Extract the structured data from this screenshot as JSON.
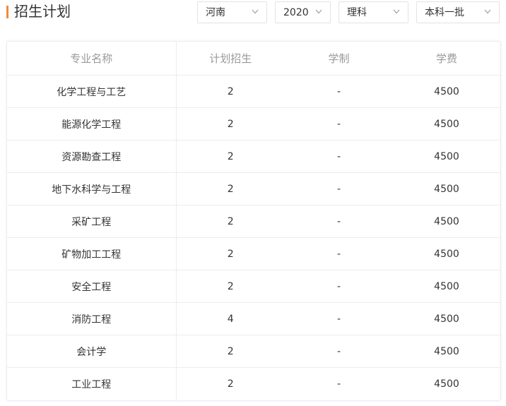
{
  "header": {
    "title": "招生计划",
    "accent_color": "#f08a3c"
  },
  "filters": {
    "province": "河南",
    "year": "2020",
    "subject": "理科",
    "batch": "本科一批",
    "dropdown_icon": "chevron-down-icon"
  },
  "table": {
    "headers": [
      "专业名称",
      "计划招生",
      "学制",
      "学费"
    ],
    "rows": [
      [
        "化学工程与工艺",
        "2",
        "-",
        "4500"
      ],
      [
        "能源化学工程",
        "2",
        "-",
        "4500"
      ],
      [
        "资源勘查工程",
        "2",
        "-",
        "4500"
      ],
      [
        "地下水科学与工程",
        "2",
        "-",
        "4500"
      ],
      [
        "采矿工程",
        "2",
        "-",
        "4500"
      ],
      [
        "矿物加工工程",
        "2",
        "-",
        "4500"
      ],
      [
        "安全工程",
        "2",
        "-",
        "4500"
      ],
      [
        "消防工程",
        "4",
        "-",
        "4500"
      ],
      [
        "会计学",
        "2",
        "-",
        "4500"
      ],
      [
        "工业工程",
        "2",
        "-",
        "4500"
      ]
    ]
  }
}
